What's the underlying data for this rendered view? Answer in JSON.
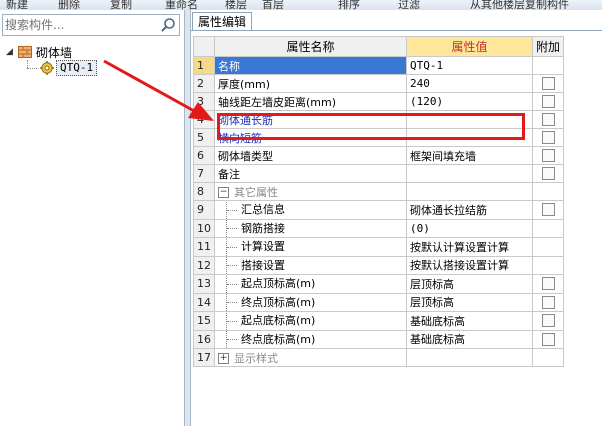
{
  "toolbar": {
    "items": [
      "新建",
      "删除",
      "复制",
      "重命名",
      "楼层",
      "首层",
      "排序",
      "过滤",
      "从其他楼层复制构件"
    ]
  },
  "sidebar": {
    "search_placeholder": "搜索构件...",
    "tree_root": "砌体墙",
    "tree_child": "QTQ-1"
  },
  "panel": {
    "tab_label": "属性编辑",
    "headers": {
      "name": "属性名称",
      "value": "属性值",
      "extra": "附加"
    }
  },
  "properties": [
    {
      "num": "1",
      "name": "名称",
      "value": "QTQ-1",
      "has_checkbox": false
    },
    {
      "num": "2",
      "name": "厚度(mm)",
      "value": "240",
      "has_checkbox": true
    },
    {
      "num": "3",
      "name": "轴线距左墙皮距离(mm)",
      "value": "(120)",
      "has_checkbox": true
    },
    {
      "num": "4",
      "name": "砌体通长筋",
      "value": "",
      "has_checkbox": true
    },
    {
      "num": "5",
      "name": "横向短筋",
      "value": "",
      "has_checkbox": true
    },
    {
      "num": "6",
      "name": "砌体墙类型",
      "value": "框架间填充墙",
      "has_checkbox": true
    },
    {
      "num": "7",
      "name": "备注",
      "value": "",
      "has_checkbox": true
    },
    {
      "num": "8",
      "name": "其它属性",
      "value": "",
      "has_checkbox": false,
      "group": "minus"
    },
    {
      "num": "9",
      "name": "汇总信息",
      "value": "砌体通长拉结筋",
      "has_checkbox": true,
      "child": true
    },
    {
      "num": "10",
      "name": "钢筋搭接",
      "value": "(0)",
      "has_checkbox": false,
      "child": true
    },
    {
      "num": "11",
      "name": "计算设置",
      "value": "按默认计算设置计算",
      "has_checkbox": false,
      "child": true
    },
    {
      "num": "12",
      "name": "搭接设置",
      "value": "按默认搭接设置计算",
      "has_checkbox": false,
      "child": true
    },
    {
      "num": "13",
      "name": "起点顶标高(m)",
      "value": "层顶标高",
      "has_checkbox": true,
      "child": true
    },
    {
      "num": "14",
      "name": "终点顶标高(m)",
      "value": "层顶标高",
      "has_checkbox": true,
      "child": true
    },
    {
      "num": "15",
      "name": "起点底标高(m)",
      "value": "基础底标高",
      "has_checkbox": true,
      "child": true
    },
    {
      "num": "16",
      "name": "终点底标高(m)",
      "value": "基础底标高",
      "has_checkbox": true,
      "child": true
    },
    {
      "num": "17",
      "name": "显示样式",
      "value": "",
      "has_checkbox": false,
      "group": "plus"
    }
  ],
  "colors": {
    "selected_row": "#3a78d6",
    "highlight_box": "#e41a1a",
    "value_header": "#ffe79a"
  }
}
